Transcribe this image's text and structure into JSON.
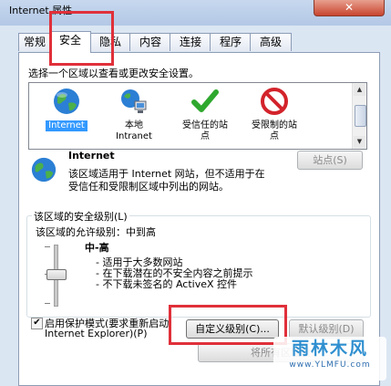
{
  "window": {
    "title": "Internet 属性",
    "close_label": "✕"
  },
  "tabs": [
    {
      "label": "常规"
    },
    {
      "label": "安全"
    },
    {
      "label": "隐私"
    },
    {
      "label": "内容"
    },
    {
      "label": "连接"
    },
    {
      "label": "程序"
    },
    {
      "label": "高级"
    }
  ],
  "active_tab": "安全",
  "security": {
    "instruction": "选择一个区域以查看或更改安全设置。",
    "zones": [
      {
        "name": "Internet",
        "icon": "globe-icon",
        "selected": true
      },
      {
        "name": "本地",
        "name2": "Intranet",
        "icon": "local-intranet-icon"
      },
      {
        "name": "受信任的站",
        "name2": "点",
        "icon": "green-check-icon"
      },
      {
        "name": "受限制的站",
        "name2": "点",
        "icon": "red-restricted-icon"
      }
    ],
    "zone_detail": {
      "title": "Internet",
      "desc_line1": "该区域适用于 Internet 网站，但不适用于在",
      "desc_line2": "受信任和受限制区域中列出的网站。",
      "sites_button": "站点(S)"
    },
    "level_group": {
      "title": "该区域的安全级别(L)",
      "allowed_levels": "该区域的允许级别：中到高",
      "current_level": "中-高",
      "bullets": [
        "- 适用于大多数网站",
        "- 在下载潜在的不安全内容之前提示",
        "- 不下载未签名的 ActiveX 控件"
      ]
    },
    "protected_mode": {
      "checked": true,
      "label_line1": "启用保护模式(要求重新启动",
      "label_line2": "Internet Explorer)(P)"
    },
    "custom_level_button": "自定义级别(C)...",
    "default_level_button": "默认级别(D)",
    "reset_all_button": "将所有区域重"
  },
  "watermark": {
    "logo": "雨林木风",
    "url": "www.YLMFU.com"
  },
  "colors": {
    "highlight": "#e0303a",
    "selection": "#3399ff"
  }
}
